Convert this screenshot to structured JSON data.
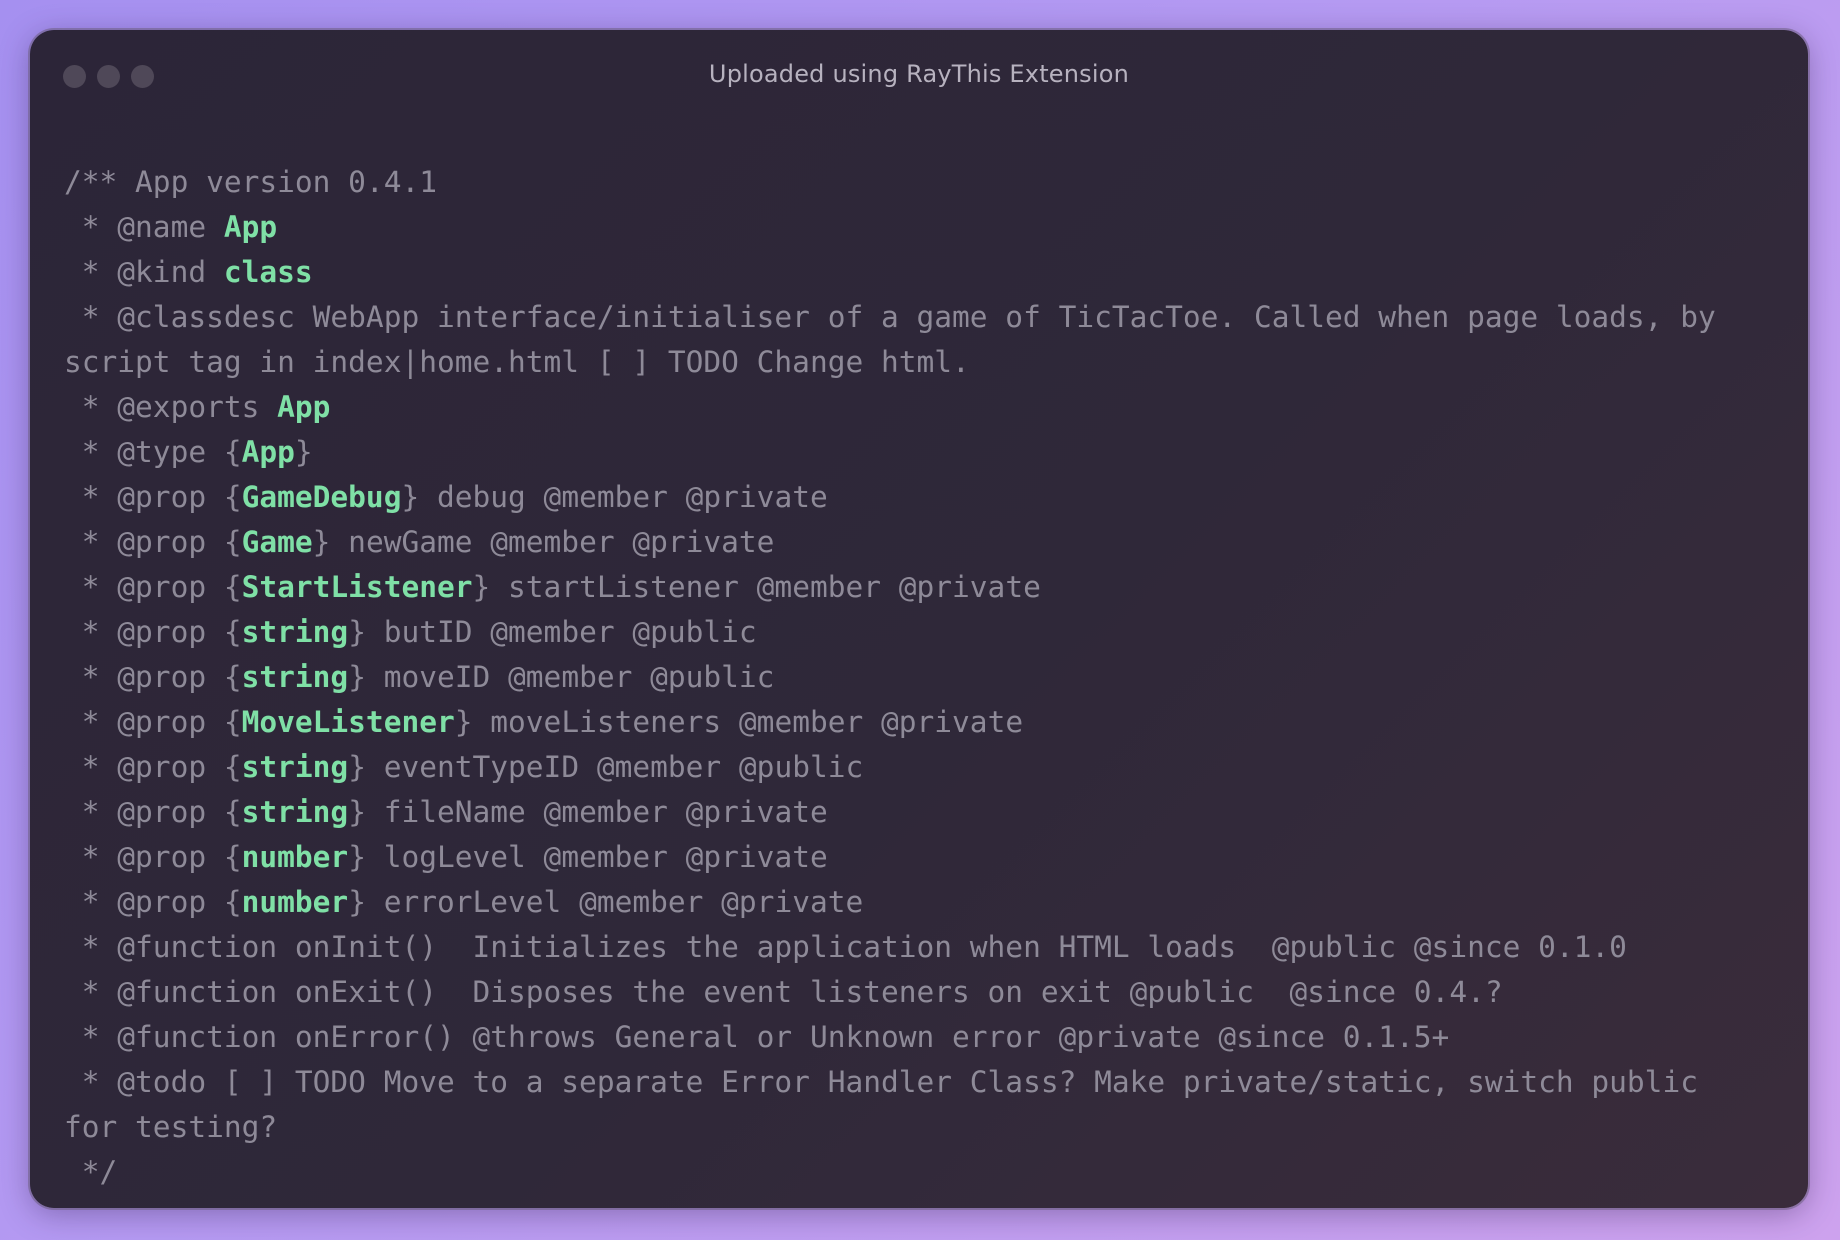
{
  "window": {
    "title": "Uploaded using RayThis Extension"
  },
  "code": {
    "lines": [
      [
        {
          "text": "/** App version 0.4.1"
        }
      ],
      [
        {
          "text": " * @name "
        },
        {
          "text": "App",
          "hl": true
        }
      ],
      [
        {
          "text": " * @kind "
        },
        {
          "text": "class",
          "hl": true
        }
      ],
      [
        {
          "text": " * @classdesc WebApp interface/initialiser of a game of TicTacToe. Called when page loads, by"
        }
      ],
      [
        {
          "text": "script tag in index|home.html [ ] TODO Change html."
        }
      ],
      [
        {
          "text": " * @exports "
        },
        {
          "text": "App",
          "hl": true
        }
      ],
      [
        {
          "text": " * @type {"
        },
        {
          "text": "App",
          "hl": true
        },
        {
          "text": "}"
        }
      ],
      [
        {
          "text": " * @prop {"
        },
        {
          "text": "GameDebug",
          "hl": true
        },
        {
          "text": "} debug @member @private"
        }
      ],
      [
        {
          "text": " * @prop {"
        },
        {
          "text": "Game",
          "hl": true
        },
        {
          "text": "} newGame @member @private"
        }
      ],
      [
        {
          "text": " * @prop {"
        },
        {
          "text": "StartListener",
          "hl": true
        },
        {
          "text": "} startListener @member @private"
        }
      ],
      [
        {
          "text": " * @prop {"
        },
        {
          "text": "string",
          "hl": true
        },
        {
          "text": "} butID @member @public"
        }
      ],
      [
        {
          "text": " * @prop {"
        },
        {
          "text": "string",
          "hl": true
        },
        {
          "text": "} moveID @member @public"
        }
      ],
      [
        {
          "text": " * @prop {"
        },
        {
          "text": "MoveListener",
          "hl": true
        },
        {
          "text": "} moveListeners @member @private"
        }
      ],
      [
        {
          "text": " * @prop {"
        },
        {
          "text": "string",
          "hl": true
        },
        {
          "text": "} eventTypeID @member @public"
        }
      ],
      [
        {
          "text": " * @prop {"
        },
        {
          "text": "string",
          "hl": true
        },
        {
          "text": "} fileName @member @private"
        }
      ],
      [
        {
          "text": " * @prop {"
        },
        {
          "text": "number",
          "hl": true
        },
        {
          "text": "} logLevel @member @private"
        }
      ],
      [
        {
          "text": " * @prop {"
        },
        {
          "text": "number",
          "hl": true
        },
        {
          "text": "} errorLevel @member @private"
        }
      ],
      [
        {
          "text": " * @function onInit()  Initializes the application when HTML loads  @public @since 0.1.0"
        }
      ],
      [
        {
          "text": " * @function onExit()  Disposes the event listeners on exit @public  @since 0.4.?"
        }
      ],
      [
        {
          "text": " * @function onError() @throws General or Unknown error @private @since 0.1.5+"
        }
      ],
      [
        {
          "text": " * @todo [ ] TODO Move to a separate Error Handler Class? Make private/static, switch public"
        }
      ],
      [
        {
          "text": "for testing?"
        }
      ],
      [
        {
          "text": " */"
        }
      ]
    ]
  },
  "colors": {
    "comment": "#8e8a98",
    "type_highlight": "#7fe0a6",
    "window_bg": "#2f2839",
    "title_text": "#b7b2bf"
  }
}
